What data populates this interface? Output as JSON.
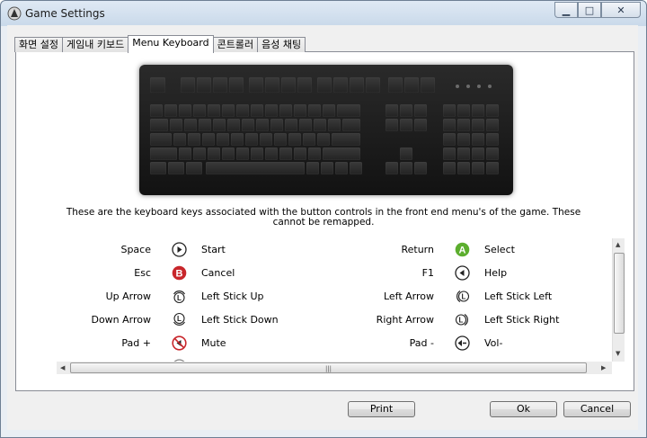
{
  "window": {
    "title": "Game Settings"
  },
  "titlebar_buttons": {
    "minimize": "▁",
    "maximize": "□",
    "close": "✕"
  },
  "tabs": [
    {
      "label": "화면 설정",
      "active": false
    },
    {
      "label": "게임내 키보드",
      "active": false
    },
    {
      "label": "Menu Keyboard",
      "active": true
    },
    {
      "label": "콘트롤러",
      "active": false
    },
    {
      "label": "음성 채팅",
      "active": false
    }
  ],
  "info_text": "These are the keyboard keys associated with the button controls in the front end menu's of the game. These cannot be remapped.",
  "controls": [
    {
      "key": "Space",
      "icon": "start-button-icon",
      "action": "Start"
    },
    {
      "key": "Return",
      "icon": "a-button-icon",
      "action": "Select"
    },
    {
      "key": "Esc",
      "icon": "b-button-icon",
      "action": "Cancel"
    },
    {
      "key": "F1",
      "icon": "back-button-icon",
      "action": "Help"
    },
    {
      "key": "Up Arrow",
      "icon": "left-stick-up-icon",
      "action": "Left Stick Up"
    },
    {
      "key": "Left Arrow",
      "icon": "left-stick-left-icon",
      "action": "Left Stick Left"
    },
    {
      "key": "Down Arrow",
      "icon": "left-stick-down-icon",
      "action": "Left Stick Down"
    },
    {
      "key": "Right Arrow",
      "icon": "left-stick-right-icon",
      "action": "Left Stick Right"
    },
    {
      "key": "Pad +",
      "icon": "mute-icon",
      "action": "Mute"
    },
    {
      "key": "Pad -",
      "icon": "volume-down-icon",
      "action": "Vol-"
    }
  ],
  "buttons": {
    "print": "Print",
    "ok": "Ok",
    "cancel": "Cancel"
  },
  "colors": {
    "a_button": "#5cae2e",
    "b_button": "#c8262b",
    "mute": "#c8262b"
  }
}
